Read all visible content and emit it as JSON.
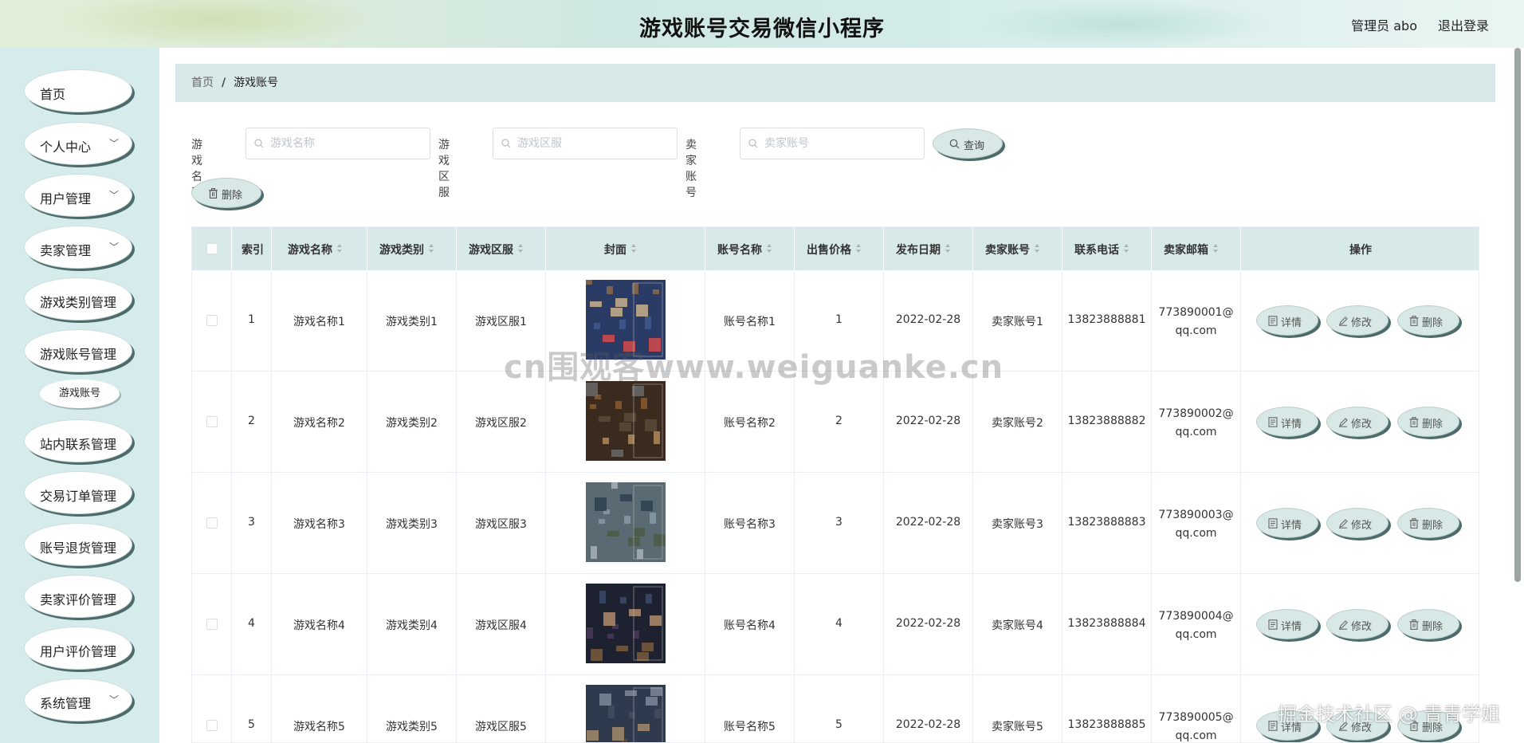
{
  "header": {
    "title": "游戏账号交易微信小程序",
    "user": "管理员 abo",
    "logout": "退出登录"
  },
  "sidebar": {
    "items": [
      {
        "label": "首页",
        "has_children": false
      },
      {
        "label": "个人中心",
        "has_children": true
      },
      {
        "label": "用户管理",
        "has_children": true
      },
      {
        "label": "卖家管理",
        "has_children": true
      },
      {
        "label": "游戏类别管理",
        "has_children": false
      },
      {
        "label": "游戏账号管理",
        "has_children": false
      },
      {
        "label": "站内联系管理",
        "has_children": false
      },
      {
        "label": "交易订单管理",
        "has_children": false
      },
      {
        "label": "账号退货管理",
        "has_children": false
      },
      {
        "label": "卖家评价管理",
        "has_children": false
      },
      {
        "label": "用户评价管理",
        "has_children": false
      },
      {
        "label": "系统管理",
        "has_children": true
      }
    ],
    "sub_item": "游戏账号"
  },
  "breadcrumb": {
    "home": "首页",
    "separator": "/",
    "current": "游戏账号"
  },
  "search": {
    "fields": [
      {
        "label": "游戏名称",
        "placeholder": "游戏名称",
        "value": ""
      },
      {
        "label": "游戏区服",
        "placeholder": "游戏区服",
        "value": ""
      },
      {
        "label": "卖家账号",
        "placeholder": "卖家账号",
        "value": ""
      }
    ],
    "query_button": "查询",
    "delete_button": "删除"
  },
  "table": {
    "headers": [
      "索引",
      "游戏名称",
      "游戏类别",
      "游戏区服",
      "封面",
      "账号名称",
      "出售价格",
      "发布日期",
      "卖家账号",
      "联系电话",
      "卖家邮箱",
      "操作"
    ],
    "actions": [
      "详情",
      "修改",
      "删除"
    ],
    "rows": [
      {
        "index": "1",
        "game_name": "游戏名称1",
        "category": "游戏类别1",
        "server": "游戏区服1",
        "account": "账号名称1",
        "price": "1",
        "date": "2022-02-28",
        "seller": "卖家账号1",
        "phone": "13823888881",
        "email_a": "773890001@",
        "email_b": "qq.com"
      },
      {
        "index": "2",
        "game_name": "游戏名称2",
        "category": "游戏类别2",
        "server": "游戏区服2",
        "account": "账号名称2",
        "price": "2",
        "date": "2022-02-28",
        "seller": "卖家账号2",
        "phone": "13823888882",
        "email_a": "773890002@",
        "email_b": "qq.com"
      },
      {
        "index": "3",
        "game_name": "游戏名称3",
        "category": "游戏类别3",
        "server": "游戏区服3",
        "account": "账号名称3",
        "price": "3",
        "date": "2022-02-28",
        "seller": "卖家账号3",
        "phone": "13823888883",
        "email_a": "773890003@",
        "email_b": "qq.com"
      },
      {
        "index": "4",
        "game_name": "游戏名称4",
        "category": "游戏类别4",
        "server": "游戏区服4",
        "account": "账号名称4",
        "price": "4",
        "date": "2022-02-28",
        "seller": "卖家账号4",
        "phone": "13823888884",
        "email_a": "773890004@",
        "email_b": "qq.com"
      },
      {
        "index": "5",
        "game_name": "游戏名称5",
        "category": "游戏类别5",
        "server": "游戏区服5",
        "account": "账号名称5",
        "price": "5",
        "date": "2022-02-28",
        "seller": "卖家账号5",
        "phone": "13823888885",
        "email_a": "773890005@",
        "email_b": "qq.com"
      }
    ]
  },
  "watermark": "cn围观客www.weiguanke.cn",
  "corner_mark": "掘金技术社区 @ 青青学姐",
  "colors": {
    "sidebar_bg": "#d6ebec",
    "header_row_bg": "#d8e9ea",
    "button_bg": "#d7e8e6",
    "button_shadow": "#4c6b6a"
  }
}
